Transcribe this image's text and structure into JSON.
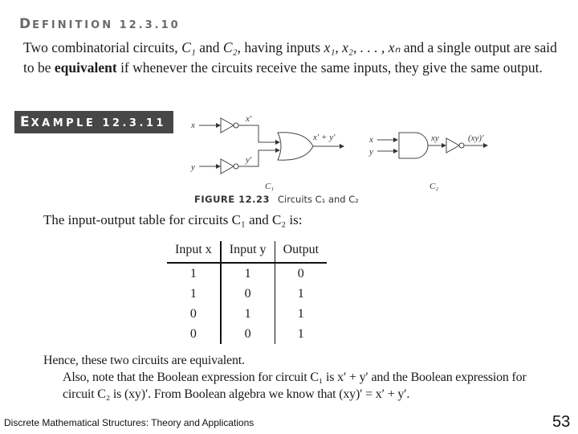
{
  "definition": {
    "heading_first": "D",
    "heading_rest": "EFINITION 12.3.10",
    "text_1": "Two combinatorial circuits, ",
    "c1": "C₁",
    "and_1": " and ",
    "c2": "C₂",
    "text_2": ", having inputs ",
    "inputs": "x₁, x₂, . . . , xₙ",
    "text_3": " and a single output are said to be ",
    "bold_term": "equivalent",
    "text_4": " if whenever the circuits receive the same inputs, they give the same output."
  },
  "example": {
    "heading_first": "E",
    "heading_rest": "XAMPLE 12.3.11"
  },
  "figure": {
    "c1_labels": {
      "x": "x",
      "y": "y",
      "xp": "x′",
      "yp": "y′",
      "out": "x′ + y′",
      "name": "C₁"
    },
    "c2_labels": {
      "x": "x",
      "y": "y",
      "xy": "xy",
      "out": "(xy)′",
      "name": "C₂"
    },
    "caption_number": "FIGURE 12.23",
    "caption_text": "Circuits C₁ and C₂"
  },
  "intro": "The input-output table for circuits C₁ and C₂ is:",
  "table": {
    "headers": [
      "Input x",
      "Input y",
      "Output"
    ],
    "rows": [
      [
        "1",
        "1",
        "0"
      ],
      [
        "1",
        "0",
        "1"
      ],
      [
        "0",
        "1",
        "1"
      ],
      [
        "0",
        "0",
        "1"
      ]
    ]
  },
  "conclusion": {
    "line1": "Hence, these two circuits are equivalent.",
    "line2": "Also, note that the Boolean expression for circuit C₁ is x′ + y′ and the Boolean expression for circuit C₂ is (xy)′. From Boolean algebra we know that (xy)′ = x′ + y′."
  },
  "footer": {
    "title": "Discrete Mathematical Structures: Theory and Applications",
    "page": "53"
  }
}
